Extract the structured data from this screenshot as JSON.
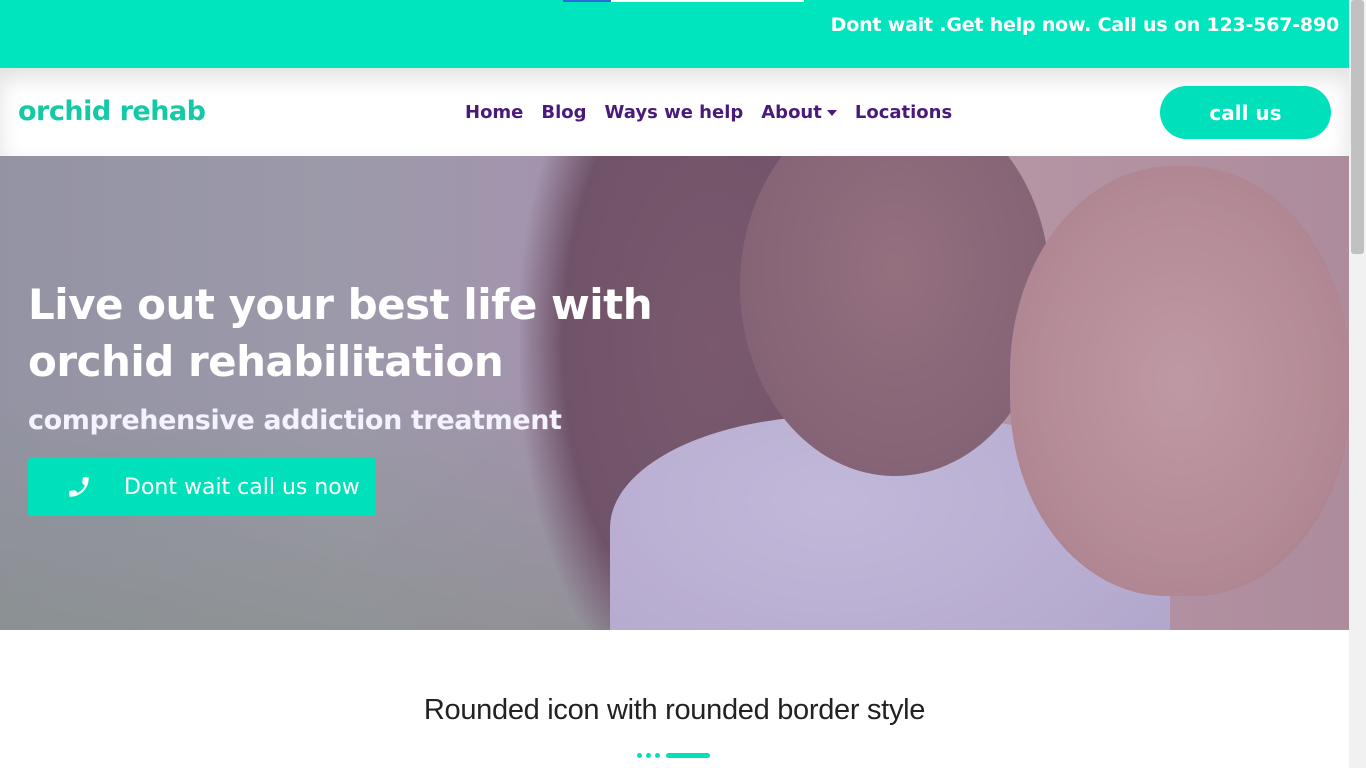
{
  "topbar": {
    "help_text": "Dont wait .Get help now. Call us on 123-567-890",
    "color": "#00e5be"
  },
  "navbar": {
    "brand": "orchid rehab",
    "links": [
      {
        "label": "Home"
      },
      {
        "label": "Blog"
      },
      {
        "label": "Ways we help"
      },
      {
        "label": "About",
        "dropdown": true
      },
      {
        "label": "Locations"
      }
    ],
    "cta_label": "call us",
    "link_color": "#4a1a7a",
    "brand_color": "#14c9a6"
  },
  "hero": {
    "title_line1": "Live out your best life with",
    "title_line2": "orchid rehabilitation",
    "subtitle": "comprehensive addiction treatment",
    "button_label": "Dont wait call us now",
    "button_icon": "phone-icon"
  },
  "section": {
    "title": "Rounded icon with rounded border style"
  }
}
